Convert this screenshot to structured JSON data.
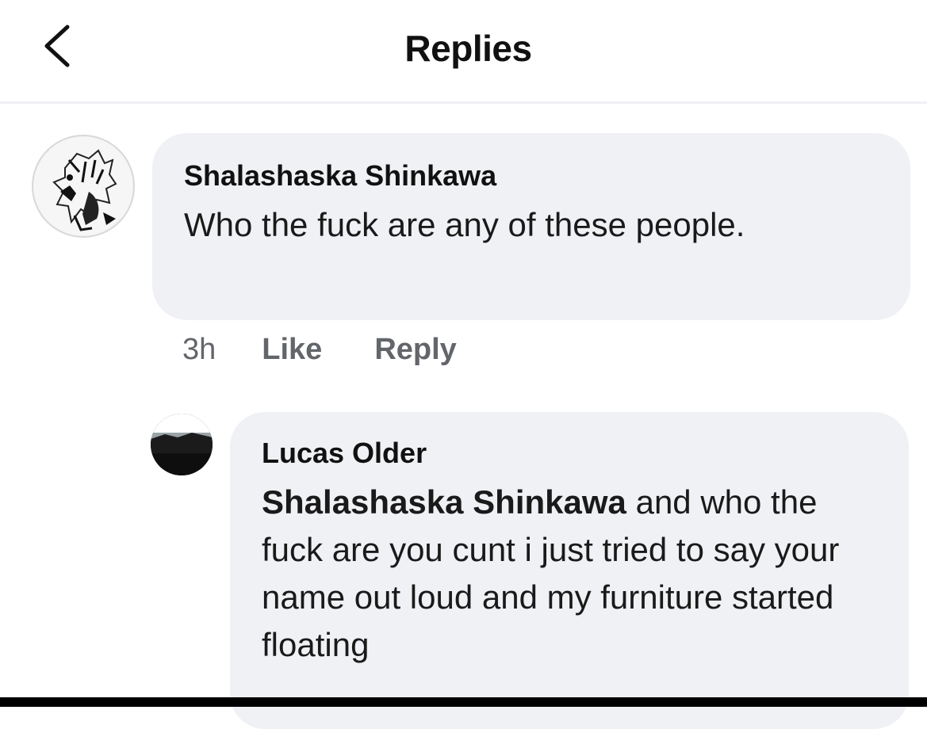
{
  "header": {
    "back_icon": "chevron-left-icon",
    "title": "Replies"
  },
  "comments": [
    {
      "author": "Shalashaska Shinkawa",
      "text": "Who the fuck are any of these people.",
      "avatar": "sketch-portrait-avatar",
      "time": "3h",
      "like_label": "Like",
      "reply_label": "Reply"
    },
    {
      "author": "Lucas Older",
      "mention": "Shalashaska Shinkawa",
      "text": " and who the fuck are you cunt i just tried to say your name out loud and my furniture started floating",
      "avatar": "landscape-photo-avatar"
    }
  ],
  "colors": {
    "bubble_bg": "#eff1f4",
    "meta_text": "#62666b",
    "divider": "#eef0f3"
  }
}
